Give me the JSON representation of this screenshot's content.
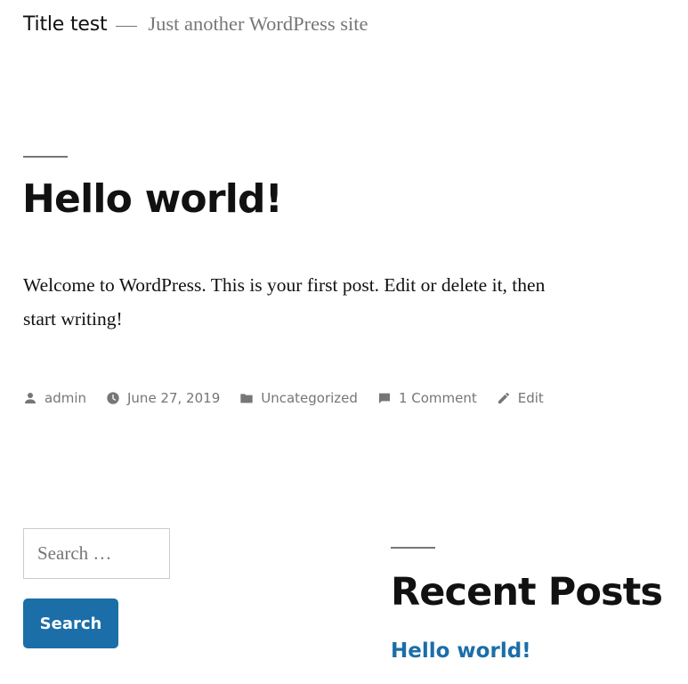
{
  "header": {
    "site_title": "Title test",
    "tagline": "Just another WordPress site"
  },
  "post": {
    "title": "Hello world!",
    "content": "Welcome to WordPress. This is your first post. Edit or delete it, then start writing!",
    "meta": {
      "author": "admin",
      "date": "June 27, 2019",
      "category": "Uncategorized",
      "comments": "1 Comment",
      "edit": "Edit"
    }
  },
  "search": {
    "placeholder": "Search …",
    "button_label": "Search"
  },
  "recent_posts": {
    "title": "Recent Posts",
    "items": [
      "Hello world!"
    ]
  },
  "colors": {
    "link": "#1b6ea8",
    "text": "#111111",
    "muted": "#767676"
  }
}
